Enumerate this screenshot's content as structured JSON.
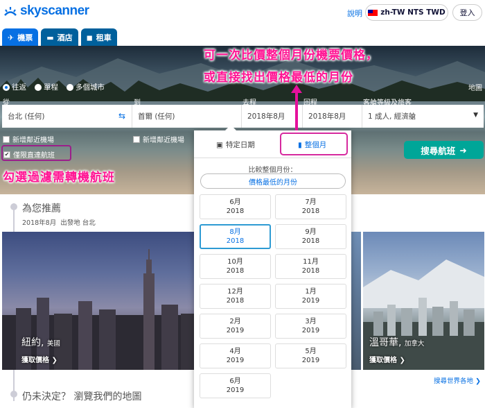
{
  "header": {
    "logo_text": "skyscanner",
    "help_label": "說明",
    "locale_label": "zh-TW NTS TWD",
    "login_label": "登入"
  },
  "tabs": [
    {
      "label": "機票",
      "icon": "plane-icon",
      "active": true
    },
    {
      "label": "酒店",
      "icon": "bed-icon",
      "active": false
    },
    {
      "label": "租車",
      "icon": "car-icon",
      "active": false
    }
  ],
  "search": {
    "trip_types": [
      {
        "label": "往返",
        "selected": true
      },
      {
        "label": "單程",
        "selected": false
      },
      {
        "label": "多個城市",
        "selected": false
      }
    ],
    "map_label": "地圖",
    "labels": {
      "from": "從",
      "to": "到",
      "depart": "去程",
      "return": "回程",
      "cabin": "客艙等級及旅客"
    },
    "from_value": "台北 (任何)",
    "to_value": "首爾 (任何)",
    "depart_value": "2018年8月",
    "return_value": "2018年8月",
    "cabin_value": "1 成人, 經濟艙",
    "nearby_from": "新增鄰近機場",
    "nearby_to": "新增鄰近機場",
    "direct_only": "僅限直達航班",
    "search_button": "搜尋航班"
  },
  "annotations": {
    "line1": "可一次比價整個月份機票價格，",
    "line2": "或直接找出價格最低的月份",
    "direct_note": "勾選過濾需轉機航班"
  },
  "datepicker": {
    "tab_specific": "特定日期",
    "tab_month": "整個月",
    "compare_label": "比較整個月份：",
    "cheapest_button": "價格最低的月份",
    "months": [
      {
        "month": "6月",
        "year": "2018",
        "selected": false
      },
      {
        "month": "7月",
        "year": "2018",
        "selected": false
      },
      {
        "month": "8月",
        "year": "2018",
        "selected": true
      },
      {
        "month": "9月",
        "year": "2018",
        "selected": false
      },
      {
        "month": "10月",
        "year": "2018",
        "selected": false
      },
      {
        "month": "11月",
        "year": "2018",
        "selected": false
      },
      {
        "month": "12月",
        "year": "2018",
        "selected": false
      },
      {
        "month": "1月",
        "year": "2019",
        "selected": false
      },
      {
        "month": "2月",
        "year": "2019",
        "selected": false
      },
      {
        "month": "3月",
        "year": "2019",
        "selected": false
      },
      {
        "month": "4月",
        "year": "2019",
        "selected": false
      },
      {
        "month": "5月",
        "year": "2019",
        "selected": false
      },
      {
        "month": "6月",
        "year": "2019",
        "selected": false
      }
    ]
  },
  "recommend": {
    "title": "為您推薦",
    "period": "2018年8月",
    "origin_label": "出發地 台北",
    "cards": [
      {
        "city": "紐約",
        "country": "美國",
        "price_label": "獲取價格"
      },
      {
        "city": "溫哥華",
        "country": "加拿大",
        "price_label": "獲取價格"
      }
    ],
    "world_link": "搜尋世界各地",
    "undecided": "仍未決定？ 瀏覽我們的地圖"
  },
  "colors": {
    "brand": "#0770e3",
    "search_button": "#00a698",
    "annotation": "#ff1493"
  }
}
